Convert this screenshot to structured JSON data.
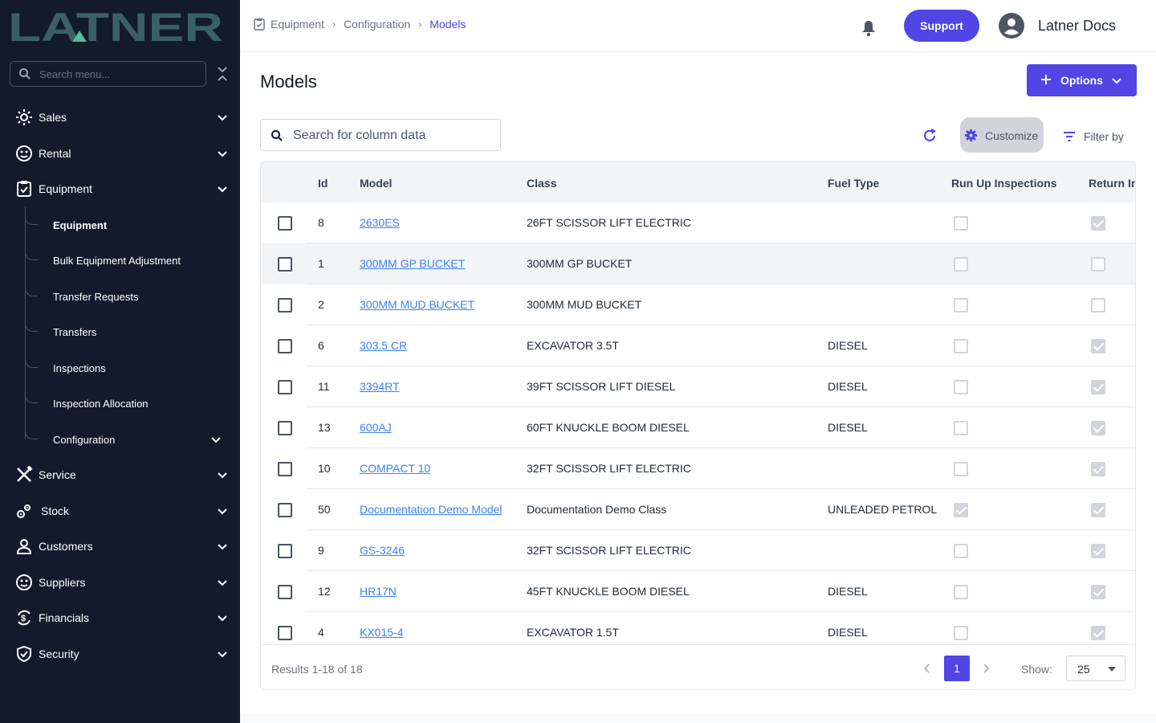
{
  "brand": {
    "logo_text": "LATNER",
    "logo_color": "#3a5f66",
    "accent_color": "#5ab8a4"
  },
  "sidebar": {
    "search_placeholder": "Search menu...",
    "items": [
      {
        "label": "Sales",
        "icon": "sun-icon"
      },
      {
        "label": "Rental",
        "icon": "face-icon"
      },
      {
        "label": "Equipment",
        "icon": "clipboard-check-icon"
      },
      {
        "label": "Service",
        "icon": "tools-icon"
      },
      {
        "label": "Stock",
        "icon": "cogs-icon"
      },
      {
        "label": "Customers",
        "icon": "person-icon"
      },
      {
        "label": "Suppliers",
        "icon": "face-icon"
      },
      {
        "label": "Financials",
        "icon": "dollar-cycle-icon"
      },
      {
        "label": "Security",
        "icon": "shield-icon"
      }
    ],
    "equipment_sub": [
      {
        "label": "Equipment"
      },
      {
        "label": "Bulk Equipment Adjustment"
      },
      {
        "label": "Transfer Requests"
      },
      {
        "label": "Transfers"
      },
      {
        "label": "Inspections"
      },
      {
        "label": "Inspection Allocation"
      },
      {
        "label": "Configuration"
      }
    ]
  },
  "header": {
    "breadcrumbs": [
      "Equipment",
      "Configuration",
      "Models"
    ],
    "support_label": "Support",
    "user_name": "Latner Docs"
  },
  "main": {
    "title": "Models",
    "options_label": "Options",
    "search_placeholder": "Search for column data",
    "customize_label": "Customize",
    "filter_label": "Filter by"
  },
  "table": {
    "columns": [
      "Id",
      "Model",
      "Class",
      "Fuel Type",
      "Run Up Inspections",
      "Return In"
    ],
    "rows": [
      {
        "id": "8",
        "model": "2630ES",
        "class": "26FT SCISSOR LIFT ELECTRIC",
        "fuel": "",
        "run_up": false,
        "return_in": true
      },
      {
        "id": "1",
        "model": "300MM GP BUCKET",
        "class": "300MM GP BUCKET",
        "fuel": "",
        "run_up": false,
        "return_in": false
      },
      {
        "id": "2",
        "model": "300MM MUD BUCKET",
        "class": "300MM MUD BUCKET",
        "fuel": "",
        "run_up": false,
        "return_in": false
      },
      {
        "id": "6",
        "model": "303.5 CR",
        "class": "EXCAVATOR 3.5T",
        "fuel": "DIESEL",
        "run_up": false,
        "return_in": true
      },
      {
        "id": "11",
        "model": "3394RT",
        "class": "39FT SCISSOR LIFT DIESEL",
        "fuel": "DIESEL",
        "run_up": false,
        "return_in": true
      },
      {
        "id": "13",
        "model": "600AJ",
        "class": "60FT KNUCKLE BOOM DIESEL",
        "fuel": "DIESEL",
        "run_up": false,
        "return_in": true
      },
      {
        "id": "10",
        "model": "COMPACT 10",
        "class": "32FT SCISSOR LIFT ELECTRIC",
        "fuel": "",
        "run_up": false,
        "return_in": true
      },
      {
        "id": "50",
        "model": "Documentation Demo Model",
        "class": "Documentation Demo Class",
        "fuel": "UNLEADED PETROL",
        "run_up": true,
        "return_in": true
      },
      {
        "id": "9",
        "model": "GS-3246",
        "class": "32FT SCISSOR LIFT ELECTRIC",
        "fuel": "",
        "run_up": false,
        "return_in": true
      },
      {
        "id": "12",
        "model": "HR17N",
        "class": "45FT KNUCKLE BOOM DIESEL",
        "fuel": "DIESEL",
        "run_up": false,
        "return_in": true
      },
      {
        "id": "4",
        "model": "KX015-4",
        "class": "EXCAVATOR 1.5T",
        "fuel": "DIESEL",
        "run_up": false,
        "return_in": true
      }
    ],
    "footer": {
      "results": "Results 1-18 of 18",
      "page": "1",
      "show_label": "Show:",
      "page_size": "25"
    }
  },
  "colors": {
    "primary": "#4f46e5",
    "sidebar_bg": "#121a2b",
    "link": "#3b82f6"
  }
}
